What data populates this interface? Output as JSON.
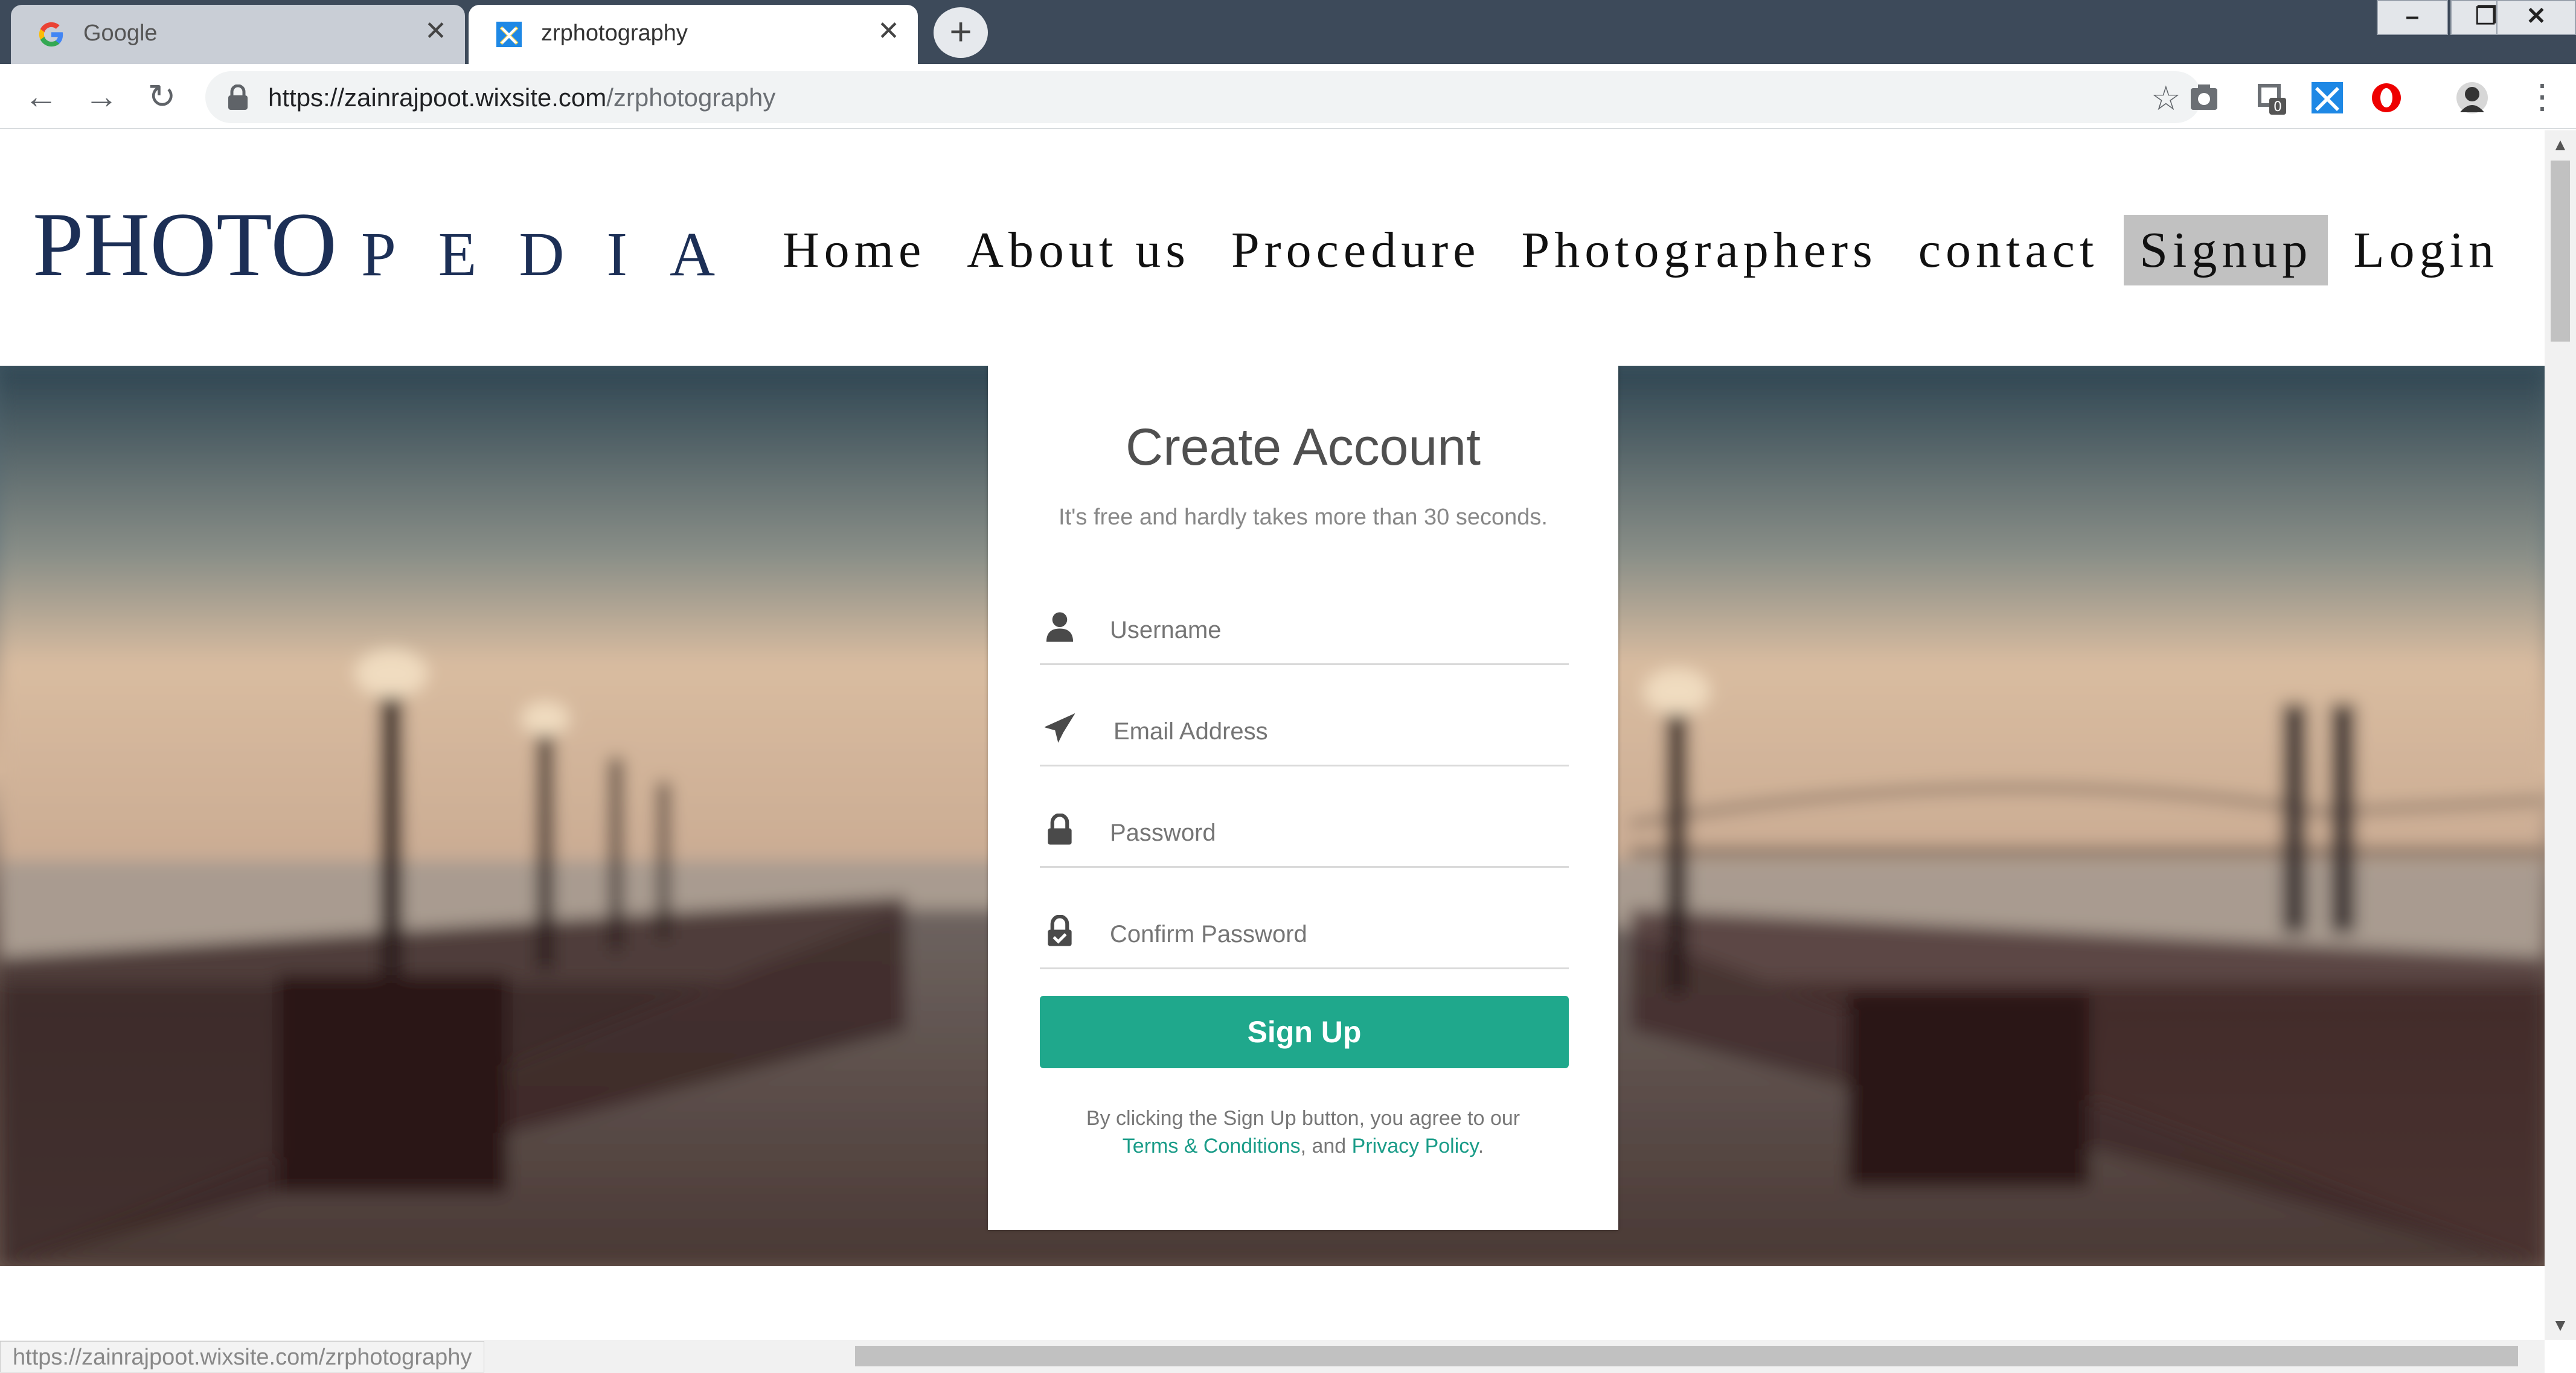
{
  "browser": {
    "tabs": [
      {
        "title": "Google",
        "active": false,
        "icon": "google-g-icon"
      },
      {
        "title": "zrphotography",
        "active": true,
        "icon": "wix-x-icon"
      }
    ],
    "new_tab": "+",
    "url_host": "https://zainrajpoot.wixsite.com",
    "url_path": "/zrphotography",
    "window_controls": [
      "minimize",
      "restore",
      "close"
    ],
    "extension_badge": "0",
    "status_url": "https://zainrajpoot.wixsite.com/zrphotography"
  },
  "site": {
    "logo_main": "PHOTO",
    "logo_sub": "PEDIA",
    "nav": [
      {
        "label": "Home",
        "active": false
      },
      {
        "label": "About us",
        "active": false
      },
      {
        "label": "Procedure",
        "active": false
      },
      {
        "label": "Photographers",
        "active": false
      },
      {
        "label": "contact",
        "active": false
      },
      {
        "label": "Signup",
        "active": true
      },
      {
        "label": "Login",
        "active": false
      }
    ]
  },
  "form": {
    "title": "Create Account",
    "subtitle": "It's free and hardly takes more than 30 seconds.",
    "fields": [
      {
        "placeholder": "Username",
        "icon": "user-icon"
      },
      {
        "placeholder": "Email Address",
        "icon": "paper-plane-icon"
      },
      {
        "placeholder": "Password",
        "icon": "lock-icon"
      },
      {
        "placeholder": "Confirm Password",
        "icon": "lock-check-icon"
      }
    ],
    "submit_label": "Sign Up",
    "legal_prefix": "By clicking the Sign Up button, you agree to our",
    "terms_link": "Terms & Conditions",
    "and_text": ", and ",
    "privacy_link": "Privacy Policy",
    "legal_suffix": "."
  },
  "colors": {
    "accent": "#1fa88c",
    "logo": "#1c2f56",
    "nav_active_bg": "#c1c1c1"
  }
}
